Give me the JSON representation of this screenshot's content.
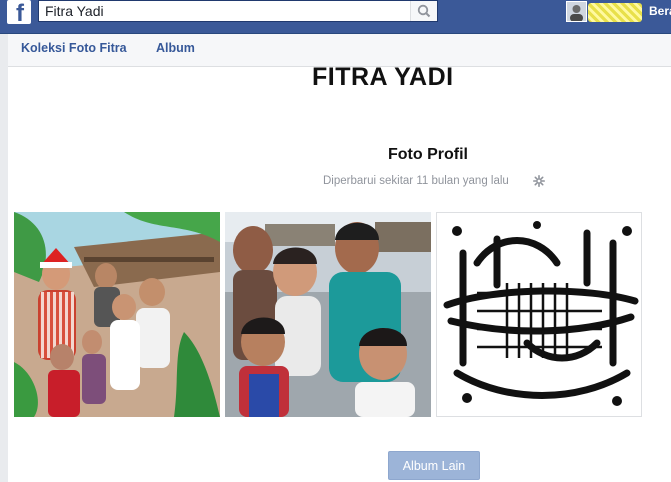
{
  "topbar": {
    "logo_letter": "f",
    "search_value": "Fitra Yadi",
    "user_link": "Beranda",
    "icons": {
      "logo": "facebook-logo-icon",
      "search": "search-icon",
      "avatar": "profile-avatar-icon"
    }
  },
  "subnav": {
    "items": [
      {
        "label": "Koleksi Foto Fitra"
      },
      {
        "label": "Album"
      }
    ]
  },
  "album": {
    "owner_name": "FITRA YADI",
    "title": "Foto Profil",
    "updated": "Diperbarui sekitar 11 bulan yang lalu",
    "more_button": "Album Lain"
  },
  "colors": {
    "brand": "#3b5998",
    "link": "#365899",
    "muted_text": "#90949c",
    "button_disabled": "#9cb4d8"
  }
}
